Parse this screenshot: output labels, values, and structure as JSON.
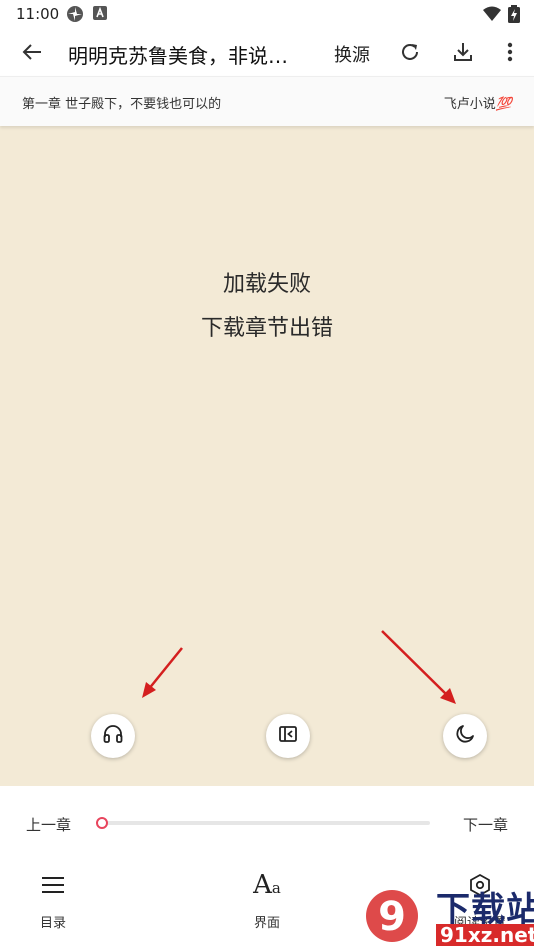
{
  "status_bar": {
    "time": "11:00",
    "icons": [
      "pinwheel-icon",
      "app-a-icon",
      "wifi-icon",
      "battery-charging-icon"
    ]
  },
  "app_bar": {
    "back_icon": "arrow-back-icon",
    "title": "明明克苏鲁美食，非说…",
    "change_source_label": "换源",
    "refresh_icon": "refresh-icon",
    "download_icon": "download-icon",
    "more_icon": "more-vert-icon"
  },
  "chapter_header": {
    "chapter_title": "第一章 世子殿下，不要钱也可以的",
    "site_name": "飞卢小说",
    "site_badge": "💯"
  },
  "reader": {
    "background_color": "#f3ead6",
    "error_line_1": "加载失败",
    "error_line_2": "下载章节出错",
    "floating_buttons": [
      "headphones-icon",
      "auto-page-icon",
      "night-mode-moon-icon"
    ]
  },
  "bottom_panel": {
    "prev_chapter_label": "上一章",
    "next_chapter_label": "下一章",
    "progress": 0,
    "accent_color": "#e8455d",
    "tabs": [
      {
        "label": "目录",
        "icon": "menu-list-icon"
      },
      {
        "label": "界面",
        "icon": "font-size-icon"
      },
      {
        "label": "阅读设置",
        "icon": "settings-hexagon-icon"
      }
    ]
  },
  "watermark": {
    "line1": "下载站",
    "line2": "91xz.net",
    "logo_text": "9"
  }
}
